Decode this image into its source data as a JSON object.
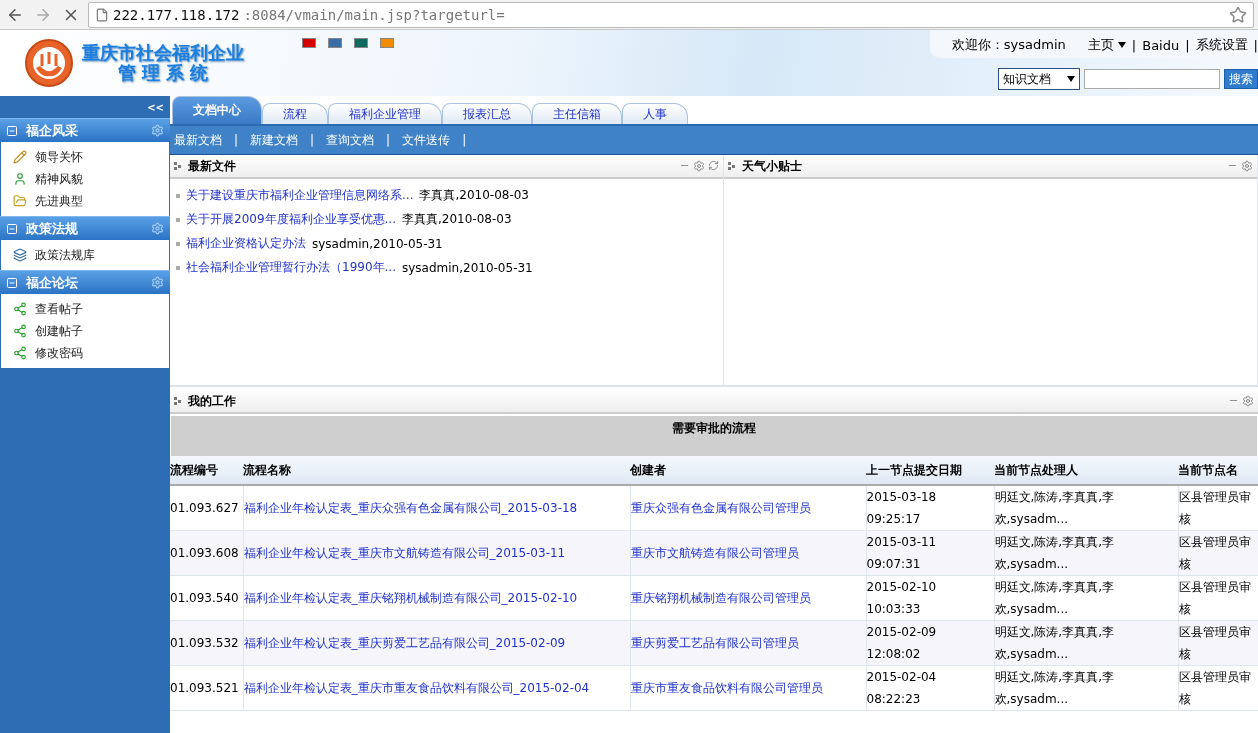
{
  "browser": {
    "url_host": "222.177.118.172",
    "url_rest": ":8084/vmain/main.jsp?targeturl="
  },
  "header": {
    "title_line1": "重庆市社会福利企业",
    "title_line2": "管 理 系 统",
    "skins": [
      {
        "color": "#d40000"
      },
      {
        "color": "#3a6ea5"
      },
      {
        "color": "#106a60"
      },
      {
        "color": "#f08a00"
      }
    ],
    "welcome": "欢迎你：sysadmin",
    "links": [
      "主页",
      "Baidu",
      "系统设置"
    ],
    "separator": "|",
    "search": {
      "scope": "知识文档",
      "button": "搜索"
    }
  },
  "sidebar": {
    "collapse": "<<",
    "sections": [
      {
        "title": "福企风采",
        "expanded": true,
        "items": [
          {
            "label": "领导关怀",
            "kind": "pencil"
          },
          {
            "label": "精神风貌",
            "kind": "person"
          },
          {
            "label": "先进典型",
            "kind": "folder"
          }
        ]
      },
      {
        "title": "政策法规",
        "expanded": true,
        "items": [
          {
            "label": "政策法规库",
            "kind": "library"
          }
        ]
      },
      {
        "title": "福企论坛",
        "expanded": true,
        "items": [
          {
            "label": "查看帖子",
            "kind": "share"
          },
          {
            "label": "创建帖子",
            "kind": "share"
          },
          {
            "label": "修改密码",
            "kind": "share"
          }
        ]
      }
    ]
  },
  "tabs": [
    {
      "label": "文档中心",
      "selected": true
    },
    {
      "label": "流程",
      "selected": false
    },
    {
      "label": "福利企业管理",
      "selected": false
    },
    {
      "label": "报表汇总",
      "selected": false
    },
    {
      "label": "主任信箱",
      "selected": false
    },
    {
      "label": "人事",
      "selected": false
    }
  ],
  "subnav": [
    "最新文档",
    "新建文档",
    "查询文档",
    "文件送传"
  ],
  "latest_files": {
    "title": "最新文件",
    "items": [
      {
        "link": "关于建设重庆市福利企业管理信息网络系...",
        "meta": "李真真,2010-08-03"
      },
      {
        "link": "关于开展2009年度福利企业享受优惠...",
        "meta": "李真真,2010-08-03"
      },
      {
        "link": "福利企业资格认定办法",
        "meta": "sysadmin,2010-05-31"
      },
      {
        "link": "社会福利企业管理暂行办法（1990年...",
        "meta": "sysadmin,2010-05-31"
      }
    ]
  },
  "weather": {
    "title": "天气小贴士"
  },
  "my_work": {
    "title": "我的工作",
    "table_title": "需要审批的流程",
    "columns": [
      "流程编号",
      "流程名称",
      "创建者",
      "上一节点提交日期",
      "当前节点处理人",
      "当前节点名"
    ],
    "rows": [
      [
        "01.093.627",
        "福利企业年检认定表_重庆众强有色金属有限公司_2015-03-18",
        "重庆众强有色金属有限公司管理员",
        "2015-03-18 09:25:17",
        "明廷文,陈涛,李真真,李欢,sysadm...",
        "区县管理员审核"
      ],
      [
        "01.093.608",
        "福利企业年检认定表_重庆市文航铸造有限公司_2015-03-11",
        "重庆市文航铸造有限公司管理员",
        "2015-03-11 09:07:31",
        "明廷文,陈涛,李真真,李欢,sysadm...",
        "区县管理员审核"
      ],
      [
        "01.093.540",
        "福利企业年检认定表_重庆铭翔机械制造有限公司_2015-02-10",
        "重庆铭翔机械制造有限公司管理员",
        "2015-02-10 10:03:33",
        "明廷文,陈涛,李真真,李欢,sysadm...",
        "区县管理员审核"
      ],
      [
        "01.093.532",
        "福利企业年检认定表_重庆剪爱工艺品有限公司_2015-02-09",
        "重庆剪爱工艺品有限公司管理员",
        "2015-02-09 12:08:02",
        "明廷文,陈涛,李真真,李欢,sysadm...",
        "区县管理员审核"
      ],
      [
        "01.093.521",
        "福利企业年检认定表_重庆市重友食品饮料有限公司_2015-02-04",
        "重庆市重友食品饮料有限公司管理员",
        "2015-02-04 08:22:23",
        "明廷文,陈涛,李真真,李欢,sysadm...",
        "区县管理员审核"
      ]
    ]
  }
}
